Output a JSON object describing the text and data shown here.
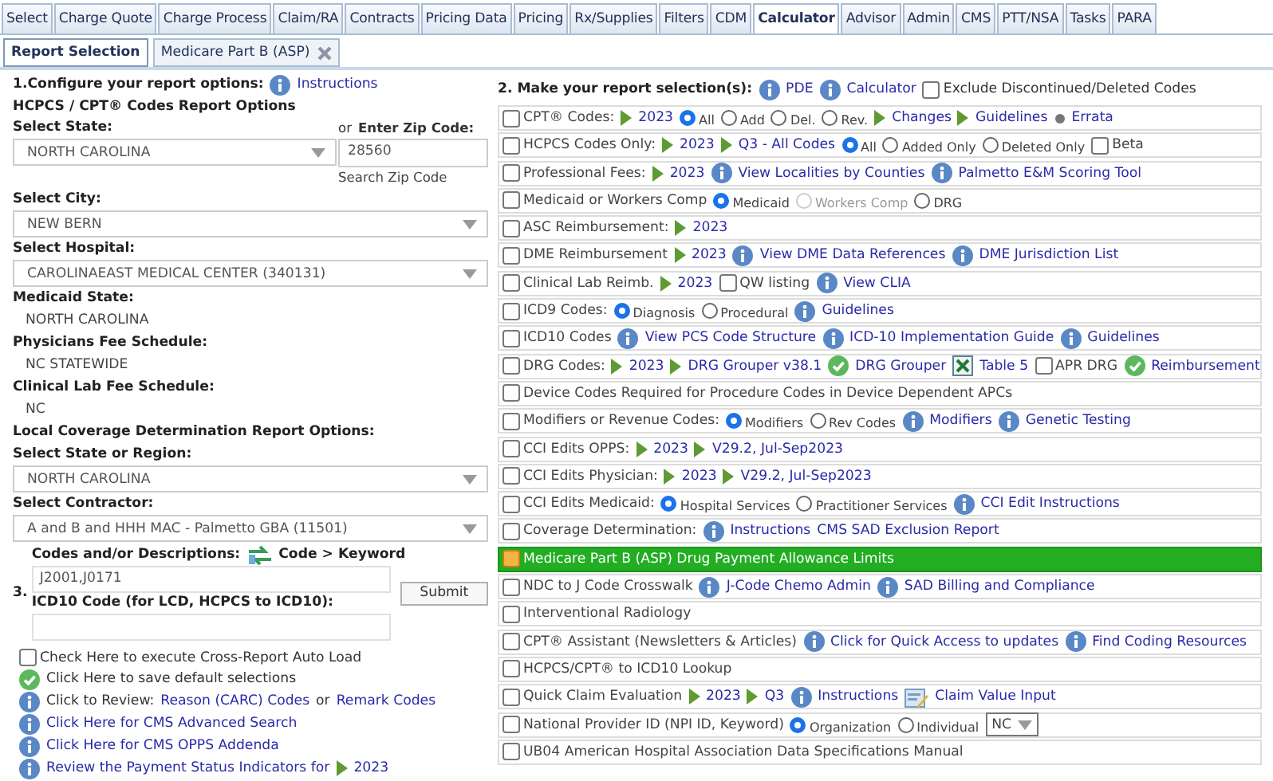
{
  "tabs": [
    {
      "label": "Select",
      "selected": false
    },
    {
      "label": "Charge Quote",
      "selected": false
    },
    {
      "label": "Charge Process",
      "selected": false
    },
    {
      "label": "Claim/RA",
      "selected": false
    },
    {
      "label": "Contracts",
      "selected": false
    },
    {
      "label": "Pricing Data",
      "selected": false
    },
    {
      "label": "Pricing",
      "selected": false
    },
    {
      "label": "Rx/Supplies",
      "selected": false
    },
    {
      "label": "Filters",
      "selected": false
    },
    {
      "label": "CDM",
      "selected": false
    },
    {
      "label": "Calculator",
      "selected": true
    },
    {
      "label": "Advisor",
      "selected": false
    },
    {
      "label": "Admin",
      "selected": false
    },
    {
      "label": "CMS",
      "selected": false
    },
    {
      "label": "PTT/NSA",
      "selected": false
    },
    {
      "label": "Tasks",
      "selected": false
    },
    {
      "label": "PARA",
      "selected": false
    }
  ],
  "subtabs": [
    {
      "label": "Report Selection",
      "selected": true,
      "closable": false
    },
    {
      "label": "Medicare Part B (ASP)",
      "selected": false,
      "closable": true
    }
  ],
  "left": {
    "heading": "1.Configure your report options:",
    "heading_link": "Instructions",
    "subheading": "HCPCS / CPT® Codes Report Options",
    "state": {
      "label": "Select State:",
      "value": "NORTH CAROLINA"
    },
    "zip": {
      "label": "or **Enter Zip Code:**",
      "value": "28560",
      "link": "Search Zip Code"
    },
    "city": {
      "label": "Select City:",
      "value": "NEW BERN"
    },
    "hospital": {
      "label": "Select Hospital:",
      "value": "CAROLINAEAST MEDICAL CENTER (340131)"
    },
    "info": [
      {
        "label": "Medicaid State:",
        "value": "NORTH CAROLINA"
      },
      {
        "label": "Physicians Fee Schedule:",
        "value": "NC STATEWIDE"
      },
      {
        "label": "Clinical Lab Fee Schedule:",
        "value": "NC"
      }
    ],
    "lcd_heading": "Local Coverage Determination Report Options:",
    "lcd_selects": [
      {
        "label": "Select State or Region:",
        "value": "NORTH CAROLINA"
      },
      {
        "label": "Select Contractor:",
        "value": "A and B and HHH MAC - Palmetto GBA (11501)"
      }
    ],
    "section3": {
      "number": "3.",
      "codes_label": "Codes and/or Descriptions:",
      "toggle": "Code > Keyword",
      "codes_value": "J2001,J0171",
      "icd_label": "ICD10 Code (for LCD, HCPCS to ICD10):",
      "submit": "Submit"
    },
    "auto_load": {
      "label": "Check Here to execute Cross-Report Auto Load",
      "checked": false
    },
    "actions": [
      {
        "kind": "ok",
        "parts": [
          {
            "kind": "text",
            "text": "Click Here to save default selections"
          }
        ]
      },
      {
        "kind": "info",
        "parts": [
          {
            "kind": "text",
            "text": "Click to Review:"
          },
          {
            "kind": "link",
            "text": "Reason (CARC) Codes"
          },
          {
            "kind": "text",
            "text": "or"
          },
          {
            "kind": "link",
            "text": "Remark Codes"
          }
        ]
      },
      {
        "kind": "info",
        "parts": [
          {
            "kind": "link",
            "text": "Click Here for CMS Advanced Search"
          }
        ]
      },
      {
        "kind": "info",
        "parts": [
          {
            "kind": "link",
            "text": "Click Here for CMS OPPS Addenda"
          }
        ]
      },
      {
        "kind": "info",
        "parts": [
          {
            "kind": "link",
            "text": "Review the Payment Status Indicators for"
          },
          {
            "kind": "play",
            "text": "2023"
          }
        ]
      }
    ]
  },
  "right": {
    "heading": "2. Make your report selection(s):",
    "heading_links": [
      "PDE",
      "Calculator"
    ],
    "exclude": {
      "label": "Exclude Discontinued/Deleted Codes",
      "checked": false
    },
    "rows": [
      {
        "label": "CPT® Codes:",
        "checked": false,
        "parts": [
          {
            "kind": "play",
            "text": "2023"
          },
          {
            "kind": "radio",
            "text": "All",
            "selected": true,
            "disabled": false
          },
          {
            "kind": "radio",
            "text": "Add",
            "selected": false,
            "disabled": false
          },
          {
            "kind": "radio",
            "text": "Del.",
            "selected": false,
            "disabled": false
          },
          {
            "kind": "radio",
            "text": "Rev.",
            "selected": false,
            "disabled": false
          },
          {
            "kind": "play",
            "text": "Changes"
          },
          {
            "kind": "play",
            "text": "Guidelines"
          },
          {
            "kind": "dot",
            "text": "Errata"
          }
        ]
      },
      {
        "label": "HCPCS Codes Only:",
        "checked": false,
        "parts": [
          {
            "kind": "play",
            "text": "2023"
          },
          {
            "kind": "play",
            "text": "Q3 - All Codes"
          },
          {
            "kind": "radio",
            "text": "All",
            "selected": true,
            "disabled": false
          },
          {
            "kind": "radio",
            "text": "Added Only",
            "selected": false,
            "disabled": false
          },
          {
            "kind": "radio",
            "text": "Deleted Only",
            "selected": false,
            "disabled": false
          },
          {
            "kind": "check",
            "text": "Beta",
            "checked": false
          }
        ]
      },
      {
        "label": "Professional Fees:",
        "checked": false,
        "parts": [
          {
            "kind": "play",
            "text": "2023"
          },
          {
            "kind": "info",
            "text": "View Localities by Counties"
          },
          {
            "kind": "info",
            "text": "Palmetto E&M Scoring Tool"
          }
        ]
      },
      {
        "label": "Medicaid or Workers Comp",
        "checked": false,
        "parts": [
          {
            "kind": "radio",
            "text": "Medicaid",
            "selected": true,
            "disabled": false
          },
          {
            "kind": "radio",
            "text": "Workers Comp",
            "selected": false,
            "disabled": true
          },
          {
            "kind": "radio",
            "text": "DRG",
            "selected": false,
            "disabled": false
          }
        ]
      },
      {
        "label": "ASC Reimbursement:",
        "checked": false,
        "parts": [
          {
            "kind": "play",
            "text": "2023"
          }
        ]
      },
      {
        "label": "DME Reimbursement",
        "checked": false,
        "parts": [
          {
            "kind": "play",
            "text": "2023"
          },
          {
            "kind": "info",
            "text": "View DME Data References"
          },
          {
            "kind": "info",
            "text": "DME Jurisdiction List"
          }
        ]
      },
      {
        "label": "Clinical Lab Reimb.",
        "checked": false,
        "parts": [
          {
            "kind": "play",
            "text": "2023"
          },
          {
            "kind": "check",
            "text": "QW listing",
            "checked": false
          },
          {
            "kind": "info",
            "text": "View CLIA"
          }
        ]
      },
      {
        "label": "ICD9 Codes:",
        "checked": false,
        "parts": [
          {
            "kind": "radio",
            "text": "Diagnosis",
            "selected": true,
            "disabled": false
          },
          {
            "kind": "radio",
            "text": "Procedural",
            "selected": false,
            "disabled": false
          },
          {
            "kind": "info",
            "text": "Guidelines"
          }
        ]
      },
      {
        "label": "ICD10 Codes",
        "checked": false,
        "parts": [
          {
            "kind": "info",
            "text": "View PCS Code Structure"
          },
          {
            "kind": "info",
            "text": "ICD-10 Implementation Guide"
          },
          {
            "kind": "info",
            "text": "Guidelines"
          }
        ]
      },
      {
        "label": "DRG Codes:",
        "checked": false,
        "parts": [
          {
            "kind": "play",
            "text": "2023"
          },
          {
            "kind": "play",
            "text": "DRG Grouper v38.1"
          },
          {
            "kind": "ok",
            "text": "DRG Grouper"
          },
          {
            "kind": "sheet",
            "text": "Table 5"
          },
          {
            "kind": "check",
            "text": "APR DRG",
            "checked": false
          },
          {
            "kind": "ok",
            "text": "Reimbursement"
          }
        ]
      },
      {
        "label": "Device Codes Required for Procedure Codes in Device Dependent APCs",
        "checked": false,
        "parts": []
      },
      {
        "label": "Modifiers or Revenue Codes:",
        "checked": false,
        "parts": [
          {
            "kind": "radio",
            "text": "Modifiers",
            "selected": true,
            "disabled": false
          },
          {
            "kind": "radio",
            "text": "Rev Codes",
            "selected": false,
            "disabled": false
          },
          {
            "kind": "info",
            "text": "Modifiers"
          },
          {
            "kind": "info",
            "text": "Genetic Testing"
          }
        ]
      },
      {
        "label": "CCI Edits OPPS:",
        "checked": false,
        "parts": [
          {
            "kind": "play",
            "text": "2023"
          },
          {
            "kind": "play",
            "text": "V29.2, Jul-Sep2023"
          }
        ]
      },
      {
        "label": "CCI Edits Physician:",
        "checked": false,
        "parts": [
          {
            "kind": "play",
            "text": "2023"
          },
          {
            "kind": "play",
            "text": "V29.2, Jul-Sep2023"
          }
        ]
      },
      {
        "label": "CCI Edits Medicaid:",
        "checked": false,
        "parts": [
          {
            "kind": "radio",
            "text": "Hospital Services",
            "selected": true,
            "disabled": false
          },
          {
            "kind": "radio",
            "text": "Practitioner Services",
            "selected": false,
            "disabled": false
          },
          {
            "kind": "info",
            "text": "CCI Edit Instructions"
          }
        ]
      },
      {
        "label": "Coverage Determination:",
        "checked": false,
        "parts": [
          {
            "kind": "info",
            "text": "Instructions"
          },
          {
            "kind": "link",
            "text": "CMS SAD Exclusion Report"
          }
        ]
      },
      {
        "label": "Medicare Part B (ASP) Drug Payment Allowance Limits",
        "checked": true,
        "parts": []
      },
      {
        "label": "NDC to J Code Crosswalk",
        "checked": false,
        "parts": [
          {
            "kind": "info",
            "text": "J-Code Chemo Admin"
          },
          {
            "kind": "info",
            "text": "SAD Billing and Compliance"
          }
        ]
      },
      {
        "label": "Interventional Radiology",
        "checked": false,
        "parts": []
      },
      {
        "label": "CPT® Assistant (Newsletters & Articles)",
        "checked": false,
        "parts": [
          {
            "kind": "info",
            "text": "Click for Quick Access to updates"
          },
          {
            "kind": "info",
            "text": "Find Coding Resources"
          }
        ]
      },
      {
        "label": "HCPCS/CPT® to ICD10 Lookup",
        "checked": false,
        "parts": []
      },
      {
        "label": "Quick Claim Evaluation",
        "checked": false,
        "parts": [
          {
            "kind": "play",
            "text": "2023"
          },
          {
            "kind": "play",
            "text": "Q3"
          },
          {
            "kind": "info",
            "text": "Instructions"
          },
          {
            "kind": "calc",
            "text": "Claim Value Input"
          }
        ]
      },
      {
        "label": "National Provider ID (NPI ID, Keyword)",
        "checked": false,
        "parts": [
          {
            "kind": "radio",
            "text": "Organization",
            "selected": true,
            "disabled": false
          },
          {
            "kind": "radio",
            "text": "Individual",
            "selected": false,
            "disabled": false
          },
          {
            "kind": "select",
            "text": "NC"
          }
        ]
      },
      {
        "label": "UB04 American Hospital Association Data Specifications Manual",
        "checked": false,
        "parts": []
      }
    ]
  }
}
